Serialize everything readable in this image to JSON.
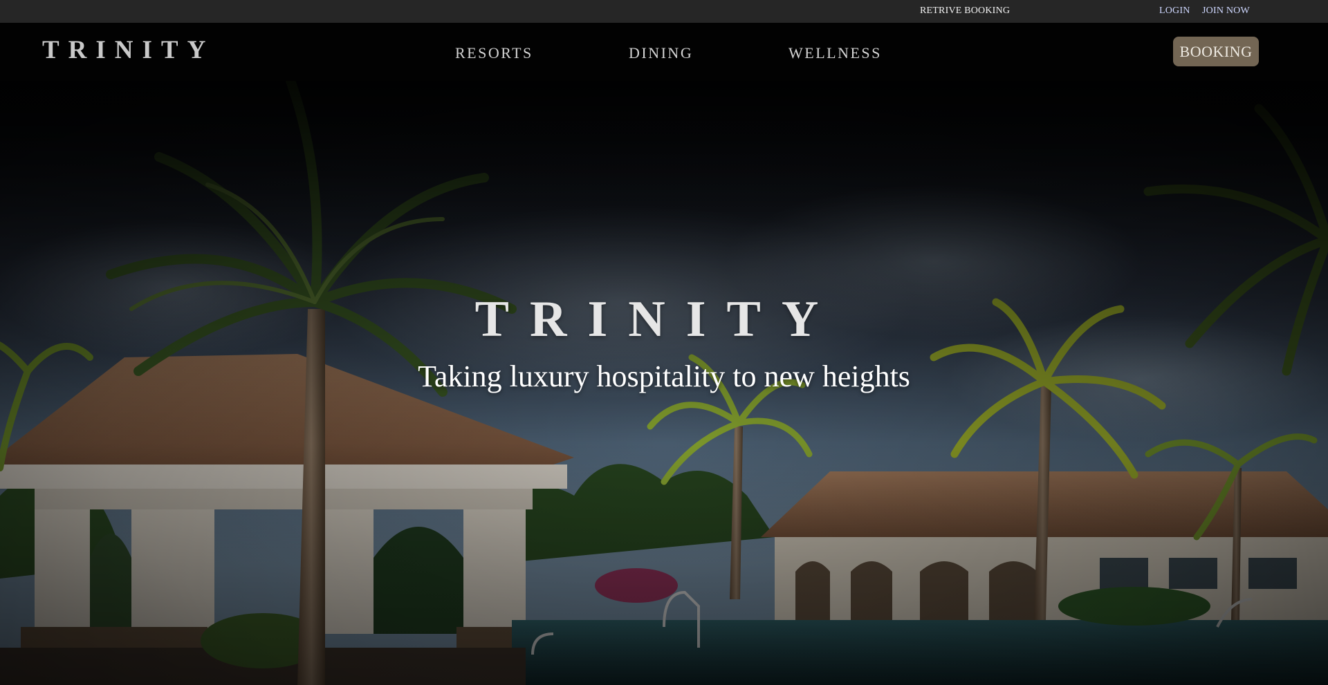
{
  "utility_bar": {
    "retrieve_booking": "RETRIVE BOOKING",
    "login": "LOGIN",
    "join_now": "JOIN NOW"
  },
  "nav": {
    "logo": "TRINITY",
    "links": [
      "RESORTS",
      "DINING",
      "WELLNESS"
    ],
    "booking_button": "BOOKING"
  },
  "hero": {
    "title": "TRINITY",
    "tagline": "Taking luxury hospitality to new heights",
    "image": "resort-pool-palms-photo"
  },
  "colors": {
    "utility_bar_bg": "#262626",
    "nav_bg": "#020202",
    "booking_button_bg": "#736654",
    "link_blue": "#cfd8ff"
  }
}
